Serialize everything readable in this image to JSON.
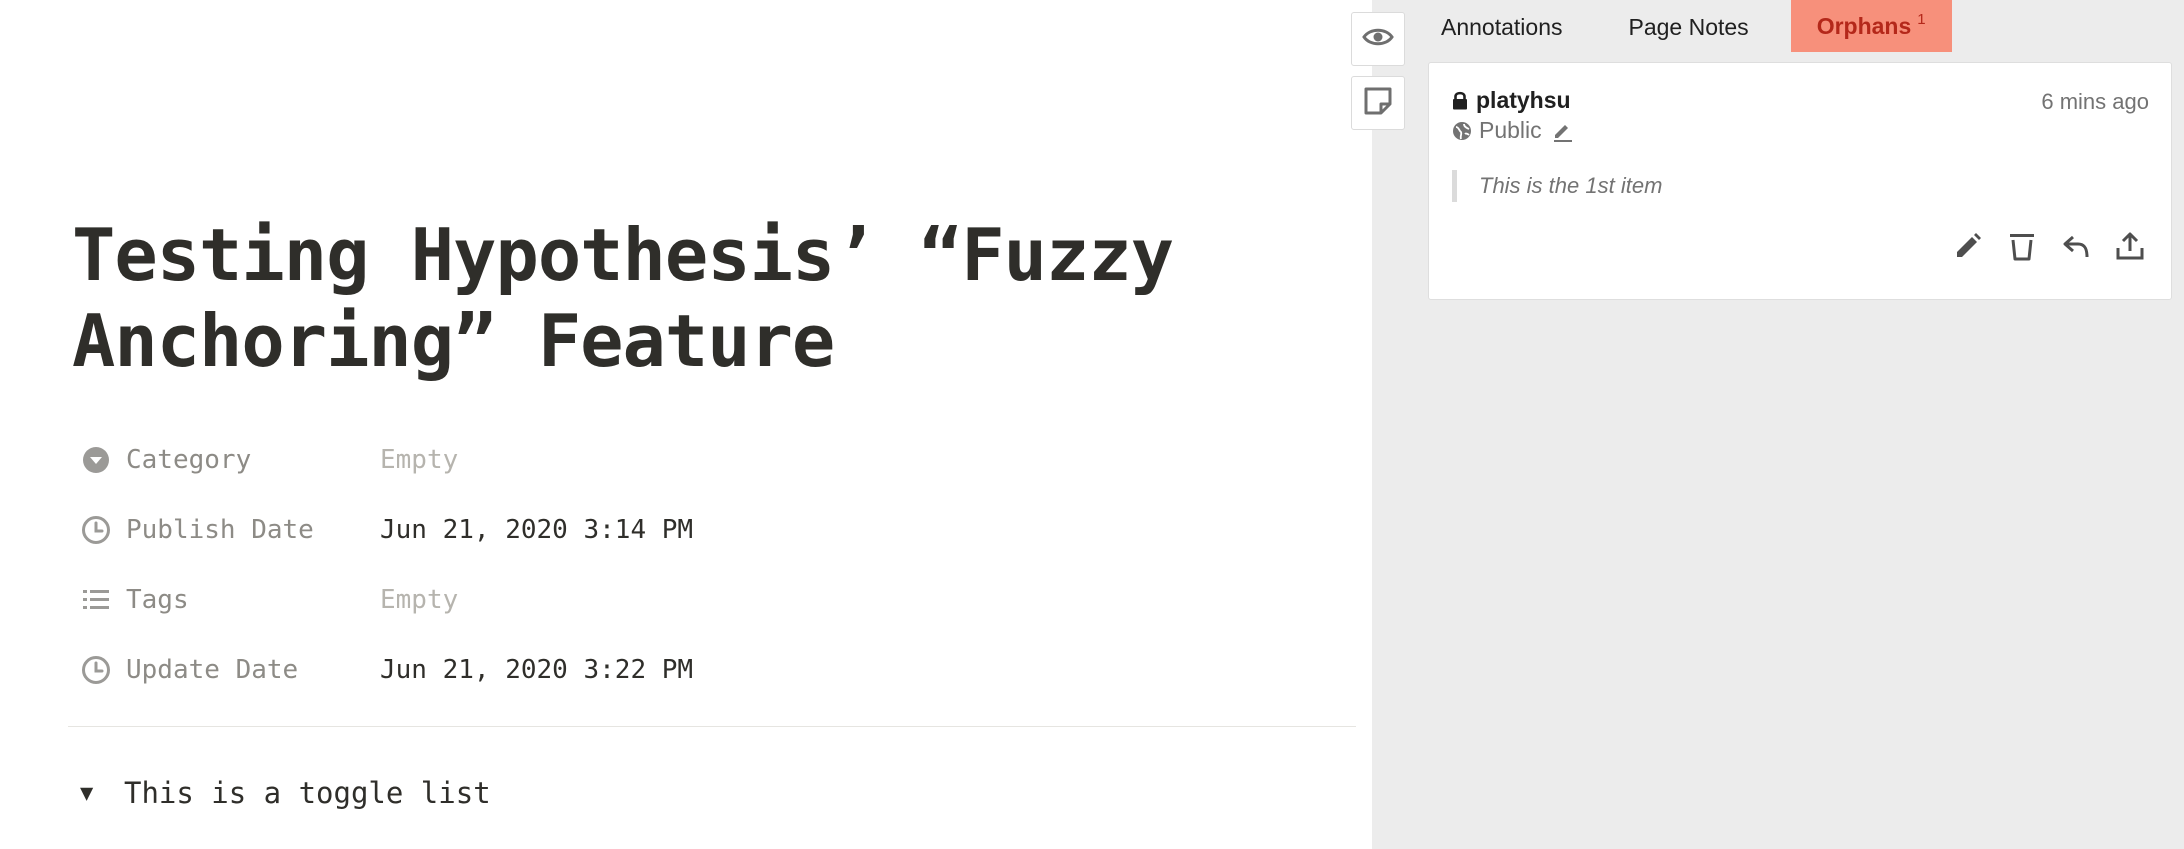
{
  "page": {
    "title": "Testing Hypothesis’ “Fuzzy Anchoring” Feature",
    "properties": [
      {
        "icon": "dropdown-circle-icon",
        "label": "Category",
        "value": "Empty"
      },
      {
        "icon": "clock-icon",
        "label": "Publish Date",
        "value": "Jun 21, 2020 3:14 PM"
      },
      {
        "icon": "list-icon",
        "label": "Tags",
        "value": "Empty"
      },
      {
        "icon": "clock-icon",
        "label": "Update Date",
        "value": "Jun 21, 2020 3:22 PM"
      }
    ],
    "toggle": {
      "arrow": "▼",
      "label": "This is a toggle list"
    }
  },
  "sidebar": {
    "toolbar": [
      {
        "icon": "eye-icon",
        "name": "show-highlights-button"
      },
      {
        "icon": "page-note-icon",
        "name": "new-page-note-button"
      }
    ],
    "tabs": {
      "annotations": "Annotations",
      "page_notes": "Page Notes",
      "orphans": "Orphans",
      "orphans_count": "1",
      "selected": "orphans"
    },
    "annotation": {
      "user": "platyhsu",
      "time": "6 mins ago",
      "group": "Public",
      "quote": "This is the 1st item",
      "actions": [
        "edit-icon",
        "delete-icon",
        "reply-icon",
        "share-icon"
      ]
    },
    "colors": {
      "sidebar_bg": "#ececec",
      "selected_tab_bg": "#f7907b",
      "selected_tab_text": "#b4281a"
    }
  }
}
